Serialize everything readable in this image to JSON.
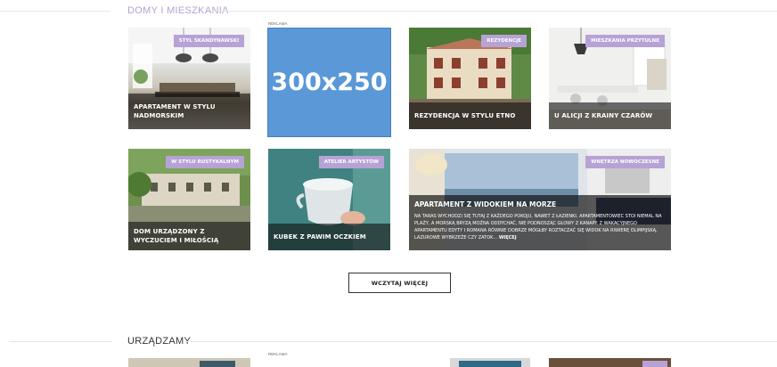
{
  "colors": {
    "accent": "#b7a2d6",
    "title_color_1": "#b6a0d6",
    "title_color_2": "#333333",
    "ad_blue": "#5a98d8"
  },
  "section1": {
    "title": "DOMY I MIESZKANIA",
    "ad_label": "REKLAMA",
    "ad_text": "300x250",
    "cards": [
      {
        "title": "APARTAMENT W STYLU NADMORSKIM",
        "badge": "STYL SKANDYNAWSKI"
      },
      {
        "title": "REZYDENCJA W STYLU ETNO",
        "badge": "REZYDENCJE"
      },
      {
        "title": "U ALICJI Z KRAINY CZARÓW",
        "badge": "MIESZKANIA PRZYTULNE"
      },
      {
        "title": "DOM URZĄDZONY Z WYCZUCIEM I MIŁOŚCIĄ",
        "badge": "W STYLU RUSTYKALNYM"
      },
      {
        "title": "KUBEK Z PAWIM OCZKIEM",
        "badge": "ATELIER ARTYSTÓW"
      }
    ],
    "wide": {
      "title": "APARTAMENT Z WIDOKIEM NA MORZE",
      "badge": "WNĘTRZA NOWOCZESNE",
      "desc": "NA TARAS WYCHODZI SIĘ TUTAJ Z KAŻDEGO POKOJU, NAWET Z ŁAZIENKI. APARTAMENTOWIEC STOI NIEMAL NA PLAŻY, A MORSKĄ BRYZĄ MOŻNA ODDYCHAĆ, NIE PODNOSZĄC GŁOWY Z KANAPY. Z WAKACYJNEGO APARTAMENTU EDYTY I ROMANA RÓWNIE DOBRZE MÓGŁBY ROZTACZAĆ SIĘ WIDOK NA RIWIERĘ OLIMPIJSKĄ, LAZUROWE WYBRZEŻE CZY ZATOK...",
      "more": "WIĘCEJ"
    },
    "load_more": "WCZYTAJ WIĘCEJ"
  },
  "section2": {
    "title": "URZĄDZAMY",
    "ad_label": "REKLAMA"
  }
}
